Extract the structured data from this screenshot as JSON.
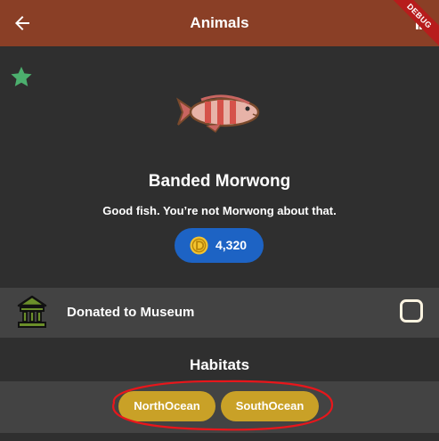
{
  "app_bar": {
    "title": "Animals",
    "debug_banner": "DEBUG",
    "back_icon": "arrow-back-icon"
  },
  "item": {
    "name": "Banded Morwong",
    "quote": "Good fish. You’re not Morwong about that.",
    "price": "4,320",
    "favorite_icon": "star-icon",
    "image": "banded-morwong-fish"
  },
  "museum": {
    "label": "Donated to Museum",
    "donated": false
  },
  "habitats": {
    "title": "Habitats",
    "chips": [
      "NorthOcean",
      "SouthOcean"
    ]
  },
  "colors": {
    "app_bar": "#8a3f26",
    "background": "#2f2f2f",
    "row": "#434343",
    "price_pill": "#1d63c4",
    "chip": "#c9a127",
    "star": "#4caf6e",
    "annotation": "#e8161b"
  }
}
